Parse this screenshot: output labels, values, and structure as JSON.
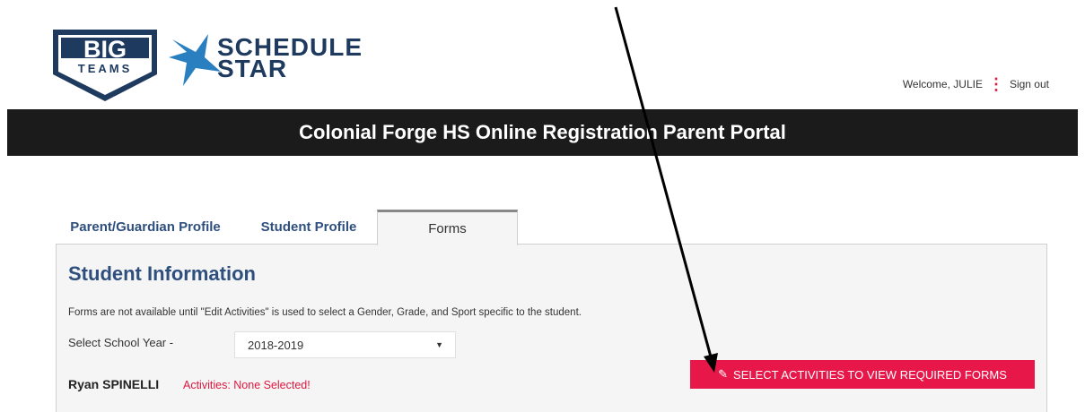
{
  "logos": {
    "big_teams_top": "BIG",
    "big_teams_bottom": "TEAMS",
    "schedule_star_line1": "SCHEDULE",
    "schedule_star_line2": "STAR"
  },
  "header": {
    "welcome": "Welcome, JULIE",
    "separator_icon": "vertical-dots-icon",
    "signout": "Sign out",
    "banner_title": "Colonial Forge HS Online Registration Parent Portal"
  },
  "tabs": [
    {
      "label": "Parent/Guardian Profile",
      "active": false
    },
    {
      "label": "Student Profile",
      "active": false
    },
    {
      "label": "Forms",
      "active": true
    }
  ],
  "panel": {
    "title": "Student Information",
    "note": "Forms are not available until \"Edit Activities\" is used to select a Gender, Grade, and Sport specific to the student.",
    "year_label": "Select School Year -",
    "year_value": "2018-2019",
    "student_name": "Ryan SPINELLI",
    "student_activities": "Activities: None Selected!",
    "activities_button": "SELECT ACTIVITIES TO VIEW REQUIRED FORMS",
    "activities_button_icon": "pencil-icon"
  },
  "colors": {
    "brand_navy": "#1e3a5f",
    "tab_blue": "#2e4f7e",
    "accent_red": "#e8174a",
    "banner_black": "#1b1b1b"
  }
}
